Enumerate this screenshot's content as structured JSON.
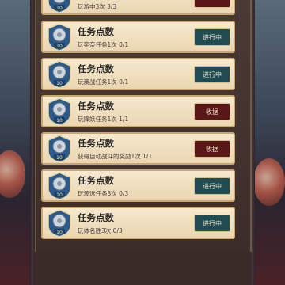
{
  "tasks": [
    {
      "title": "",
      "desc": "玩游中3次 3/3",
      "button": "",
      "status": "claim"
    },
    {
      "title": "任务点数",
      "desc": "玩奕奈任务1次 0/1",
      "button": "进行中",
      "status": "progress"
    },
    {
      "title": "任务点数",
      "desc": "玩澳战任务1次 0/1",
      "button": "进行中",
      "status": "progress"
    },
    {
      "title": "任务点数",
      "desc": "玩降妖任务1次 1/1",
      "button": "收据",
      "status": "claim"
    },
    {
      "title": "任务点数",
      "desc": "获得自动战斗的奖励1次 1/1",
      "button": "收据",
      "status": "claim"
    },
    {
      "title": "任务点数",
      "desc": "玩源远任务3次 0/3",
      "button": "进行中",
      "status": "progress"
    },
    {
      "title": "任务点数",
      "desc": "玩体名胜3次 0/3",
      "button": "进行中",
      "status": "progress"
    }
  ],
  "badge": {
    "value": "10",
    "icon": "gear-medal-icon"
  },
  "colors": {
    "row_bg": "#f1e2c3",
    "progress_button": "#1f4c52",
    "claim_button": "#5a1717",
    "badge_blue": "#2b5a8c"
  }
}
